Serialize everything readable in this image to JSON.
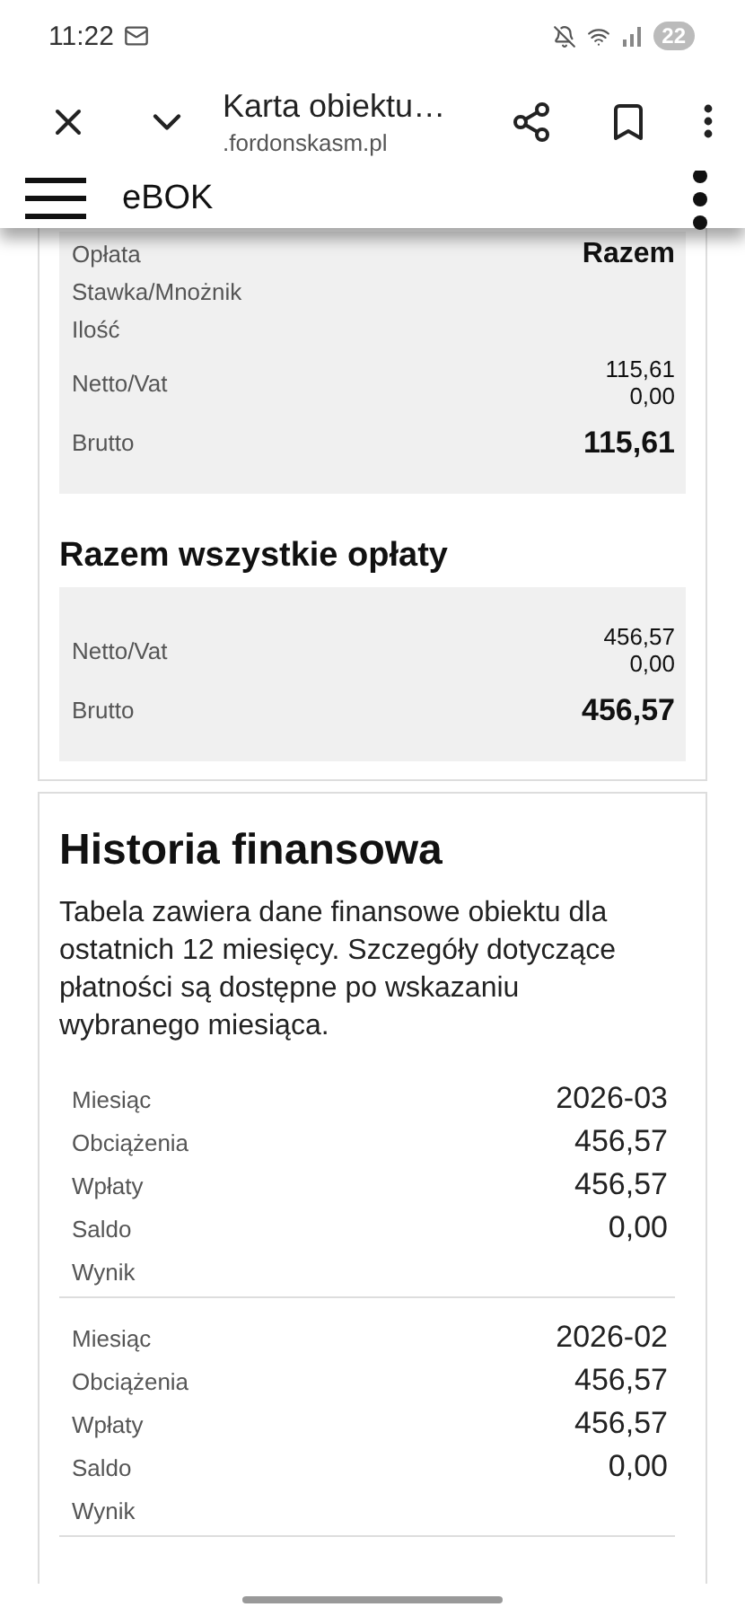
{
  "status_bar": {
    "time": "11:22",
    "battery": "22"
  },
  "browser": {
    "title": "Karta obiektu…",
    "url": ".fordonskasm.pl"
  },
  "app_header": {
    "title": "eBOK"
  },
  "charge_table": {
    "label": "Opłata",
    "total_label": "Razem",
    "rows": [
      {
        "kind": "plain",
        "label": "Stawka/Mnożnik"
      },
      {
        "kind": "plain",
        "label": "Ilość"
      },
      {
        "kind": "pair",
        "label": "Netto/Vat",
        "values": [
          "115,61",
          "0,00"
        ]
      },
      {
        "kind": "total",
        "label": "Brutto",
        "values": [
          "115,61"
        ]
      }
    ]
  },
  "all_charges": {
    "title": "Razem wszystkie opłaty",
    "rows": [
      {
        "kind": "pair",
        "label": "Netto/Vat",
        "values": [
          "456,57",
          "0,00"
        ]
      },
      {
        "kind": "total",
        "label": "Brutto",
        "values": [
          "456,57"
        ]
      }
    ]
  },
  "history": {
    "title": "Historia finansowa",
    "description": "Tabela zawiera dane finansowe obiektu dla ostatnich 12 miesięcy. Szczegóły dotyczące płatności są dostępne po wskazaniu wybranego miesiąca.",
    "months": [
      {
        "rows": [
          {
            "label": "Miesiąc",
            "value": "2026-03"
          },
          {
            "label": "Obciążenia",
            "value": "456,57"
          },
          {
            "label": "Wpłaty",
            "value": "456,57"
          },
          {
            "label": "Saldo",
            "value": "0,00"
          },
          {
            "label": "Wynik"
          }
        ]
      },
      {
        "rows": [
          {
            "label": "Miesiąc",
            "value": "2026-02"
          },
          {
            "label": "Obciążenia",
            "value": "456,57"
          },
          {
            "label": "Wpłaty",
            "value": "456,57"
          },
          {
            "label": "Saldo",
            "value": "0,00"
          },
          {
            "label": "Wynik"
          }
        ]
      }
    ]
  }
}
